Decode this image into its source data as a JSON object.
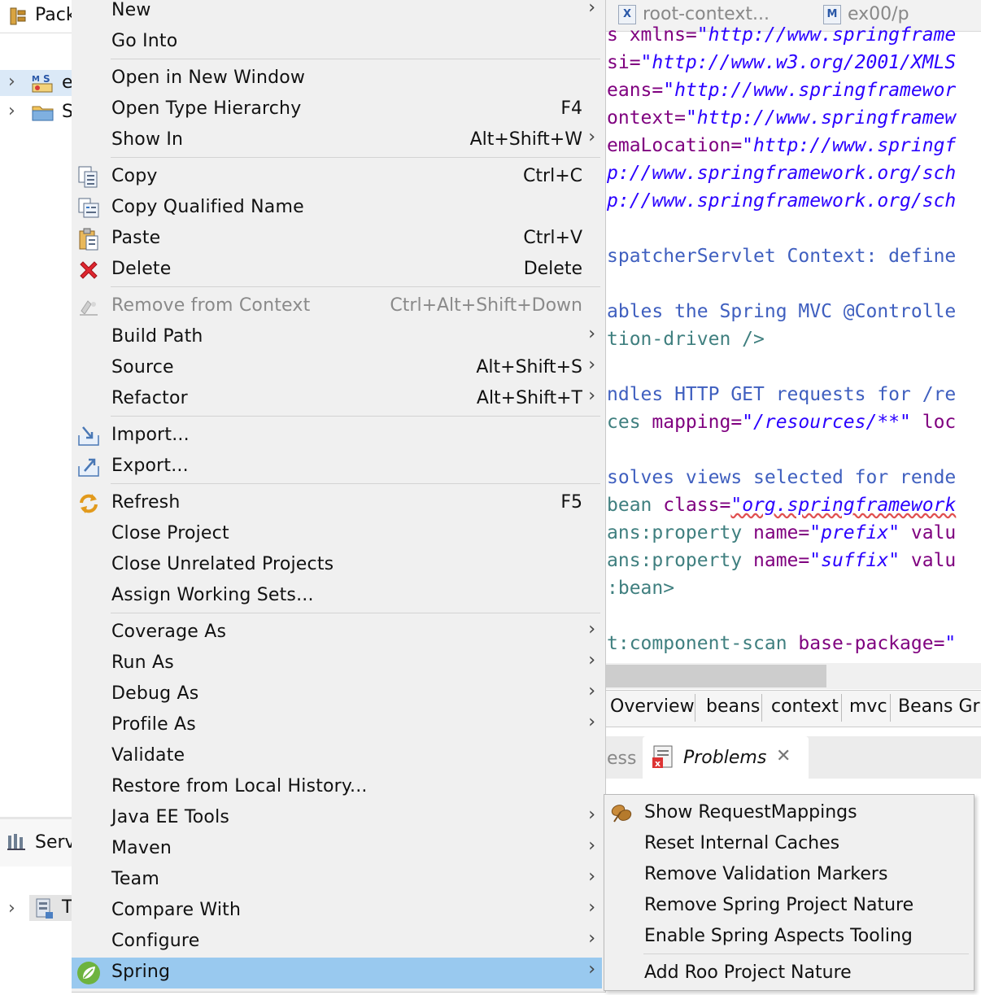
{
  "explorer": {
    "tab_label": "Pack",
    "tree": [
      {
        "text": "e"
      },
      {
        "text": "S"
      }
    ],
    "servers_tab_label": "Serv",
    "servers_row_text": "T"
  },
  "editor": {
    "tabs": [
      "root-context...",
      "ex00/p"
    ],
    "code": [
      {
        "parts": [
          [
            "s xmlns=",
            "attr"
          ],
          [
            "\"http://www.springframe",
            "str"
          ]
        ]
      },
      {
        "parts": [
          [
            "si=",
            "attr"
          ],
          [
            "\"http://www.w3.org/2001/XMLS",
            "str"
          ]
        ]
      },
      {
        "parts": [
          [
            "eans=",
            "attr"
          ],
          [
            "\"http://www.springframewor",
            "str"
          ]
        ]
      },
      {
        "parts": [
          [
            "ontext=",
            "attr"
          ],
          [
            "\"http://www.springframew",
            "str"
          ]
        ]
      },
      {
        "parts": [
          [
            "emaLocation=",
            "attr"
          ],
          [
            "\"http://www.springf",
            "str"
          ]
        ]
      },
      {
        "parts": [
          [
            "p://www.springframework.org/sch",
            "str"
          ]
        ]
      },
      {
        "parts": [
          [
            "p://www.springframework.org/sch",
            "str"
          ]
        ]
      },
      {
        "parts": [
          [
            "spatcherServlet Context: define",
            "com"
          ]
        ]
      },
      {
        "parts": [
          [
            "ables the Spring MVC @Controlle",
            "com"
          ]
        ]
      },
      {
        "parts": [
          [
            "tion-driven />",
            "tag"
          ]
        ]
      },
      {
        "parts": [
          [
            "ndles HTTP GET requests for /re",
            "com"
          ]
        ]
      },
      {
        "parts": [
          [
            "ces ",
            "tag"
          ],
          [
            "mapping=",
            "attr"
          ],
          [
            "\"/resources/**\"",
            "str"
          ],
          [
            " loc",
            "attr"
          ]
        ]
      },
      {
        "parts": [
          [
            "solves views selected for rende",
            "com"
          ]
        ]
      },
      {
        "parts": [
          [
            "bean ",
            "tag"
          ],
          [
            "class=",
            "attr"
          ],
          [
            "\"org.springframework",
            "str"
          ]
        ]
      },
      {
        "parts": [
          [
            "ans:property ",
            "tag"
          ],
          [
            "name=",
            "attr"
          ],
          [
            "\"prefix\"",
            "str"
          ],
          [
            " valu",
            "attr"
          ]
        ]
      },
      {
        "parts": [
          [
            "ans:property ",
            "tag"
          ],
          [
            "name=",
            "attr"
          ],
          [
            "\"suffix\"",
            "str"
          ],
          [
            " valu",
            "attr"
          ]
        ]
      },
      {
        "parts": [
          [
            ":bean>",
            "tag"
          ]
        ]
      },
      {
        "parts": [
          [
            "t:component-scan ",
            "tag"
          ],
          [
            "base-package=",
            "attr"
          ],
          [
            "\"",
            "str"
          ]
        ]
      }
    ],
    "bottom_tabs": [
      "Overview",
      "beans",
      "context",
      "mvc",
      "Beans Gra"
    ],
    "views": {
      "partial_label": "ess",
      "problems_label": "Problems",
      "close_glyph": "✕"
    }
  },
  "context_menu": {
    "items": [
      {
        "label": "New",
        "shortcut": "",
        "submenu": true
      },
      {
        "label": "Go Into",
        "shortcut": "",
        "submenu": false
      },
      {
        "label": "Open in New Window",
        "shortcut": "",
        "submenu": false
      },
      {
        "label": "Open Type Hierarchy",
        "shortcut": "F4",
        "submenu": false
      },
      {
        "label": "Show In",
        "shortcut": "Alt+Shift+W",
        "submenu": true
      },
      {
        "label": "Copy",
        "shortcut": "Ctrl+C",
        "submenu": false,
        "icon": "copy-icon"
      },
      {
        "label": "Copy Qualified Name",
        "shortcut": "",
        "submenu": false,
        "icon": "copy-qualified-name-icon"
      },
      {
        "label": "Paste",
        "shortcut": "Ctrl+V",
        "submenu": false,
        "icon": "paste-icon"
      },
      {
        "label": "Delete",
        "shortcut": "Delete",
        "submenu": false,
        "icon": "delete-icon"
      },
      {
        "label": "Remove from Context",
        "shortcut": "Ctrl+Alt+Shift+Down",
        "submenu": false,
        "disabled": true,
        "icon": "remove-from-context-icon"
      },
      {
        "label": "Build Path",
        "shortcut": "",
        "submenu": true
      },
      {
        "label": "Source",
        "shortcut": "Alt+Shift+S",
        "submenu": true
      },
      {
        "label": "Refactor",
        "shortcut": "Alt+Shift+T",
        "submenu": true
      },
      {
        "label": "Import...",
        "shortcut": "",
        "submenu": false,
        "icon": "import-icon"
      },
      {
        "label": "Export...",
        "shortcut": "",
        "submenu": false,
        "icon": "export-icon"
      },
      {
        "label": "Refresh",
        "shortcut": "F5",
        "submenu": false,
        "icon": "refresh-icon"
      },
      {
        "label": "Close Project",
        "shortcut": "",
        "submenu": false
      },
      {
        "label": "Close Unrelated Projects",
        "shortcut": "",
        "submenu": false
      },
      {
        "label": "Assign Working Sets...",
        "shortcut": "",
        "submenu": false
      },
      {
        "label": "Coverage As",
        "shortcut": "",
        "submenu": true
      },
      {
        "label": "Run As",
        "shortcut": "",
        "submenu": true
      },
      {
        "label": "Debug As",
        "shortcut": "",
        "submenu": true
      },
      {
        "label": "Profile As",
        "shortcut": "",
        "submenu": true
      },
      {
        "label": "Validate",
        "shortcut": "",
        "submenu": false
      },
      {
        "label": "Restore from Local History...",
        "shortcut": "",
        "submenu": false
      },
      {
        "label": "Java EE Tools",
        "shortcut": "",
        "submenu": true
      },
      {
        "label": "Maven",
        "shortcut": "",
        "submenu": true
      },
      {
        "label": "Team",
        "shortcut": "",
        "submenu": true
      },
      {
        "label": "Compare With",
        "shortcut": "",
        "submenu": true
      },
      {
        "label": "Configure",
        "shortcut": "",
        "submenu": true
      },
      {
        "label": "Spring",
        "shortcut": "",
        "submenu": true,
        "highlighted": true,
        "icon": "spring-icon"
      }
    ],
    "arrow_glyph": "›"
  },
  "spring_submenu": {
    "items": [
      {
        "label": "Show RequestMappings",
        "icon": "request-mappings-icon"
      },
      {
        "label": "Reset Internal Caches"
      },
      {
        "label": "Remove Validation Markers"
      },
      {
        "label": "Remove Spring Project Nature"
      },
      {
        "label": "Enable Spring Aspects Tooling"
      },
      {
        "label": "Add Roo Project Nature"
      }
    ]
  },
  "colors": {
    "highlight": "#99c9ef",
    "menu_bg": "#f0f0f0",
    "xml_attr": "#7f007f",
    "xml_string": "#2a00ff",
    "xml_comment": "#3f5fbf",
    "xml_tag": "#3f7f7f"
  }
}
